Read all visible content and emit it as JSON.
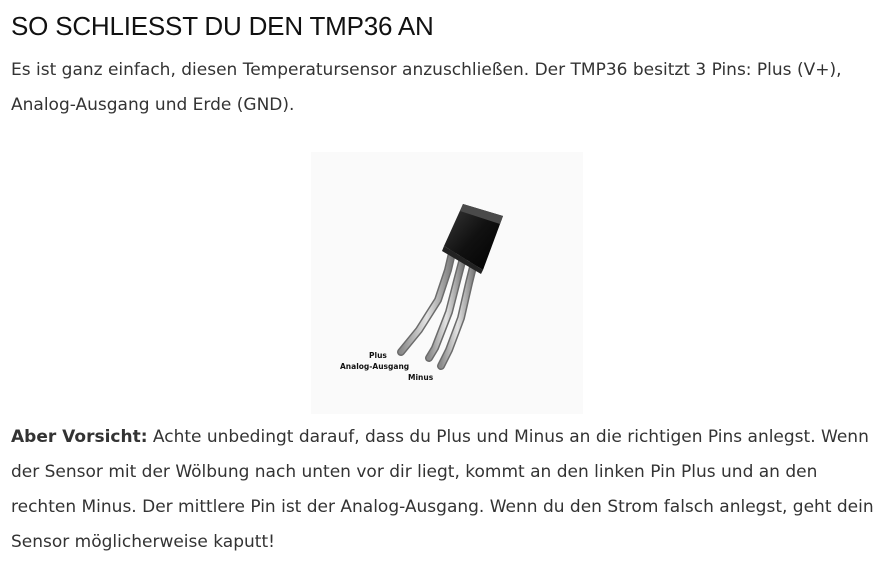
{
  "article": {
    "title": "SO SCHLIESST DU DEN TMP36 AN",
    "intro": "Es ist ganz einfach, diesen Temperatursensor anzuschließen. Der TMP36 besitzt 3 Pins: Plus (V+), Analog-Ausgang und Erde (GND).",
    "figure": {
      "pin_labels": {
        "plus": "Plus",
        "analog": "Analog-Ausgang",
        "minus": "Minus"
      }
    },
    "warning": {
      "lead": "Aber Vorsicht:",
      "text": " Achte unbedingt darauf, dass du Plus und Minus an die richtigen Pins anlegst. Wenn der Sensor mit der Wölbung nach unten vor dir liegt, kommt an den linken Pin Plus und an den rechten Minus. Der mittlere Pin ist der Analog-Ausgang. Wenn du den Strom falsch anlegst, geht dein Sensor möglicherweise kaputt!"
    }
  }
}
